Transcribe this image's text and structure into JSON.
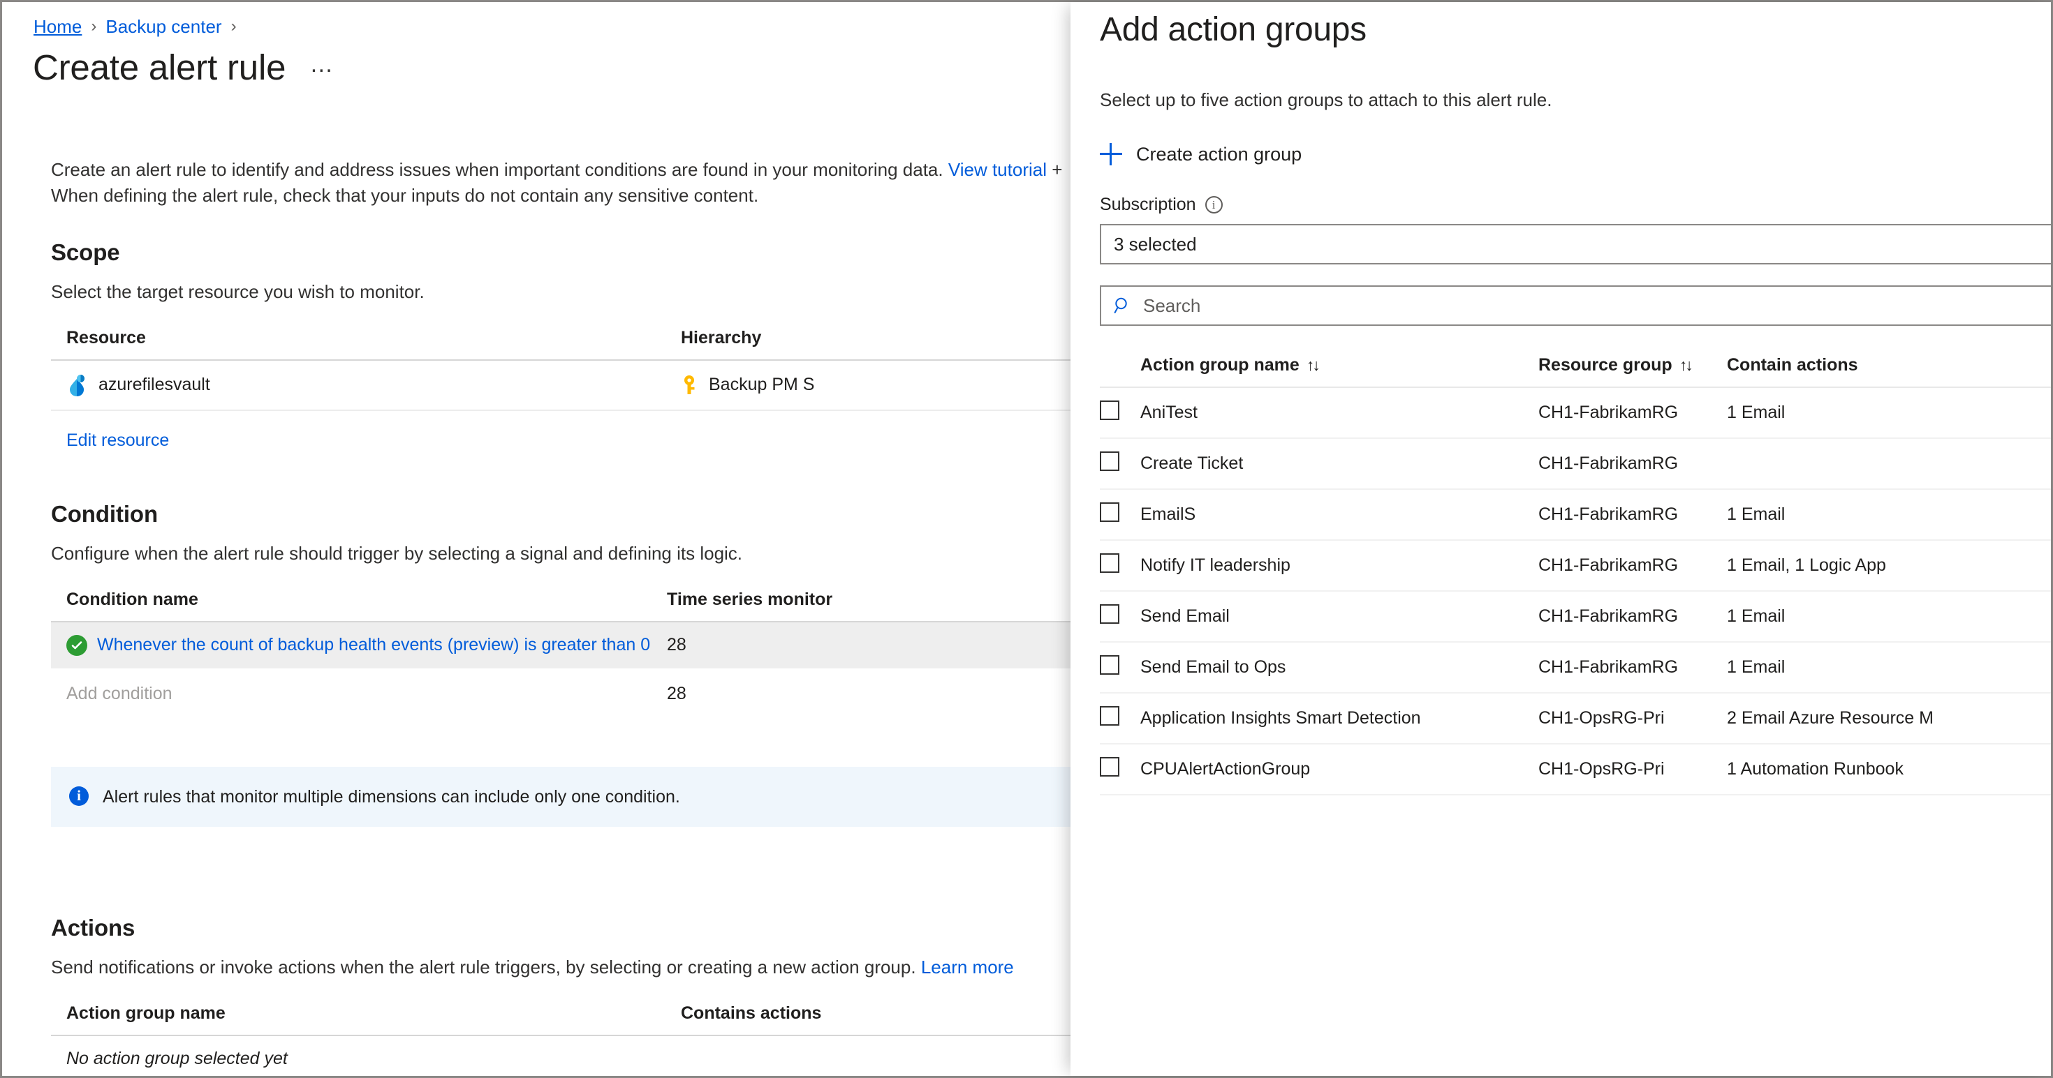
{
  "colors": {
    "link": "#015cda",
    "success": "#2d9c33",
    "info_bg": "#eff6fc",
    "row_selected_bg": "#eeeeee",
    "border": "#8a8886"
  },
  "breadcrumb": {
    "items": [
      {
        "label": "Home"
      },
      {
        "label": "Backup center"
      }
    ],
    "separator": "›"
  },
  "header": {
    "title": "Create alert rule",
    "more_label": "…"
  },
  "intro": {
    "line1_a": "Create an alert rule to identify and address issues when important conditions are found in your monitoring data. ",
    "line1_link": "View tutorial",
    "line1_b": " +",
    "line2": "When defining the alert rule, check that your inputs do not contain any sensitive content."
  },
  "scope": {
    "heading": "Scope",
    "subtitle": "Select the target resource you wish to monitor.",
    "columns": [
      "Resource",
      "Hierarchy"
    ],
    "rows": [
      {
        "resource": "azurefilesvault",
        "resource_icon": "recovery-vault-icon",
        "hierarchy": "Backup PM S",
        "hierarchy_icon": "key-icon"
      }
    ],
    "edit_resource_label": "Edit resource"
  },
  "condition": {
    "heading": "Condition",
    "subtitle": "Configure when the alert rule should trigger by selecting a signal and defining its logic.",
    "columns": [
      "Condition name",
      "Time series monitor"
    ],
    "rows": [
      {
        "name": "Whenever the count of backup health events (preview) is greater than 0",
        "time_series": "28",
        "status_icon": "check-circle-icon",
        "selected": true
      }
    ],
    "add_condition_label": "Add condition",
    "add_condition_time_series": "28"
  },
  "info_banner": {
    "icon": "info-icon",
    "text": "Alert rules that monitor multiple dimensions can include only one condition."
  },
  "actions": {
    "heading": "Actions",
    "subtitle_a": "Send notifications or invoke actions when the alert rule triggers, by selecting or creating a new action group. ",
    "subtitle_link": "Learn more",
    "columns": [
      "Action group name",
      "Contains actions"
    ],
    "empty_text": "No action group selected yet"
  },
  "flyout": {
    "title": "Add action groups",
    "subtitle": "Select up to five action groups to attach to this alert rule.",
    "create_action_group_label": "Create action group",
    "create_icon": "plus-icon",
    "subscription": {
      "label": "Subscription",
      "info_icon": "info-circle-icon",
      "value": "3 selected"
    },
    "search": {
      "placeholder": "Search",
      "value": "",
      "icon": "search-icon"
    },
    "table": {
      "columns": [
        {
          "label": "Action group name",
          "sortable": true,
          "sort_icon": "↑↓"
        },
        {
          "label": "Resource group",
          "sortable": true,
          "sort_icon": "↑↓"
        },
        {
          "label": "Contain actions",
          "sortable": false,
          "sort_icon": ""
        }
      ],
      "rows": [
        {
          "checked": false,
          "name": "AniTest",
          "resource_group": "CH1-FabrikamRG",
          "contain_actions": "1 Email"
        },
        {
          "checked": false,
          "name": "Create Ticket",
          "resource_group": "CH1-FabrikamRG",
          "contain_actions": ""
        },
        {
          "checked": false,
          "name": "EmailS",
          "resource_group": "CH1-FabrikamRG",
          "contain_actions": "1 Email"
        },
        {
          "checked": false,
          "name": "Notify IT leadership",
          "resource_group": "CH1-FabrikamRG",
          "contain_actions": "1 Email, 1 Logic App"
        },
        {
          "checked": false,
          "name": "Send Email",
          "resource_group": "CH1-FabrikamRG",
          "contain_actions": "1 Email"
        },
        {
          "checked": false,
          "name": "Send Email to Ops",
          "resource_group": "CH1-FabrikamRG",
          "contain_actions": "1 Email"
        },
        {
          "checked": false,
          "name": "Application Insights Smart Detection",
          "resource_group": "CH1-OpsRG-Pri",
          "contain_actions": "2 Email Azure Resource M"
        },
        {
          "checked": false,
          "name": "CPUAlertActionGroup",
          "resource_group": "CH1-OpsRG-Pri",
          "contain_actions": "1 Automation Runbook"
        }
      ]
    }
  }
}
